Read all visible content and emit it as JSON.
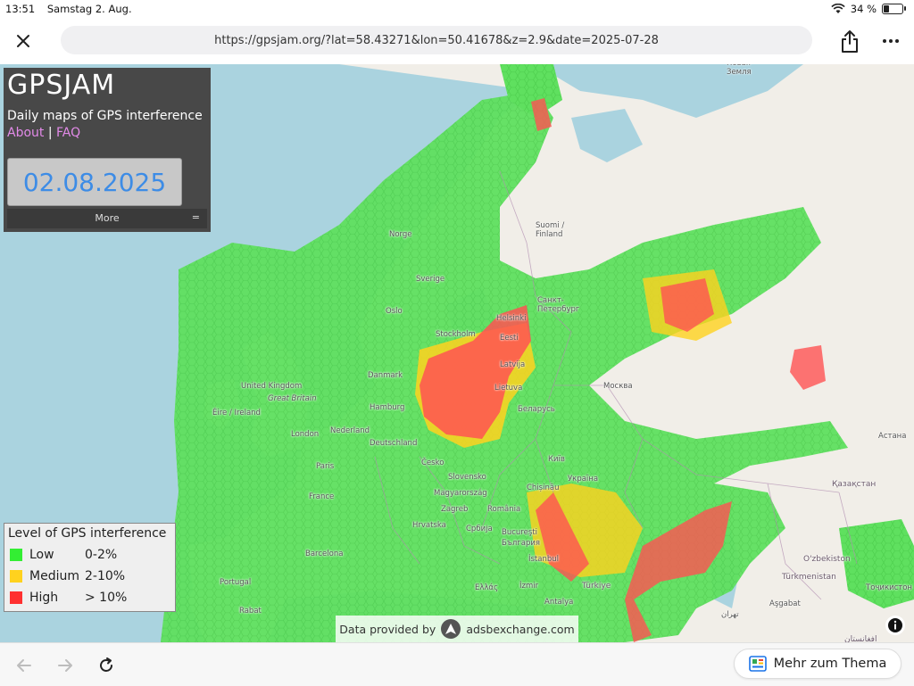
{
  "status_bar": {
    "time": "13:51",
    "date": "Samstag 2. Aug.",
    "battery_text": "34 %",
    "battery_level": 0.34,
    "icons": [
      "wifi-icon",
      "battery-icon"
    ]
  },
  "browser": {
    "url": "https://gpsjam.org/?lat=58.43271&lon=50.41678&z=2.9&date=2025-07-28",
    "icons": [
      "close-icon",
      "share-icon",
      "more-icon",
      "back-icon",
      "forward-icon",
      "reload-icon",
      "topic-icon"
    ],
    "topic_button_label": "Mehr zum Thema"
  },
  "panel": {
    "title": "GPSJAM",
    "subtitle": "Daily maps of GPS interference",
    "about_link": "About",
    "separator": "|",
    "faq_link": "FAQ",
    "date_value": "02.08.2025",
    "more_label": "More",
    "more_icon": "="
  },
  "legend": {
    "title": "Level of GPS interference",
    "levels": [
      {
        "name": "Low",
        "range": "0-2%",
        "color": "#33ee33"
      },
      {
        "name": "Medium",
        "range": "2-10%",
        "color": "#ffd21e"
      },
      {
        "name": "High",
        "range": "> 10%",
        "color": "#ff3030"
      }
    ]
  },
  "attribution": {
    "prefix": "Data provided by",
    "provider": "adsbexchange.com"
  },
  "map_labels": {
    "norge": "Norge",
    "sverige": "Sverige",
    "suomi": "Suomi /\nFinland",
    "oslo": "Oslo",
    "stockholm": "Stockholm",
    "helsinki": "Helsinki",
    "spb": "Санкт-\nПетербург",
    "eesti": "Eesti",
    "latvija": "Latvija",
    "lietuva": "Lietuva",
    "danmark": "Danmark",
    "uk": "United Kingdom",
    "gb": "Great Britain",
    "eire": "Éire / Ireland",
    "london": "London",
    "nederland": "Nederland",
    "hamburg": "Hamburg",
    "deutschland": "Deutschland",
    "paris": "Paris",
    "france": "France",
    "cesko": "Česko",
    "slovensko": "Slovensko",
    "magyar": "Magyarország",
    "zagreb": "Zagreb",
    "hrvatska": "Hrvatska",
    "romania": "România",
    "srbija": "Србија",
    "bucuresti": "Bucureşti",
    "bulgaria": "България",
    "chisinau": "Chișinău",
    "ukraina": "Україна",
    "kyiv": "Київ",
    "belarus": "Беларусь",
    "moskva": "Москва",
    "kazakhstan": "Қазақстан",
    "astana": "Астана",
    "ozbekiston": "O'zbekiston",
    "turkmenistan": "Türkmenistan",
    "tojikiston": "Тоҷикистон",
    "asgabat": "Aşgabat",
    "barcelona": "Barcelona",
    "portugal": "Portugal",
    "rabat": "Rabat",
    "ellas": "Ελλάς",
    "izmir": "İzmir",
    "antalya": "Antalya",
    "istanbul": "İstanbul",
    "turkiye": "Türkiye",
    "tehran": "تهران",
    "afghanistan": "افغانستان",
    "ostrov": "Новая\nЗемля"
  }
}
